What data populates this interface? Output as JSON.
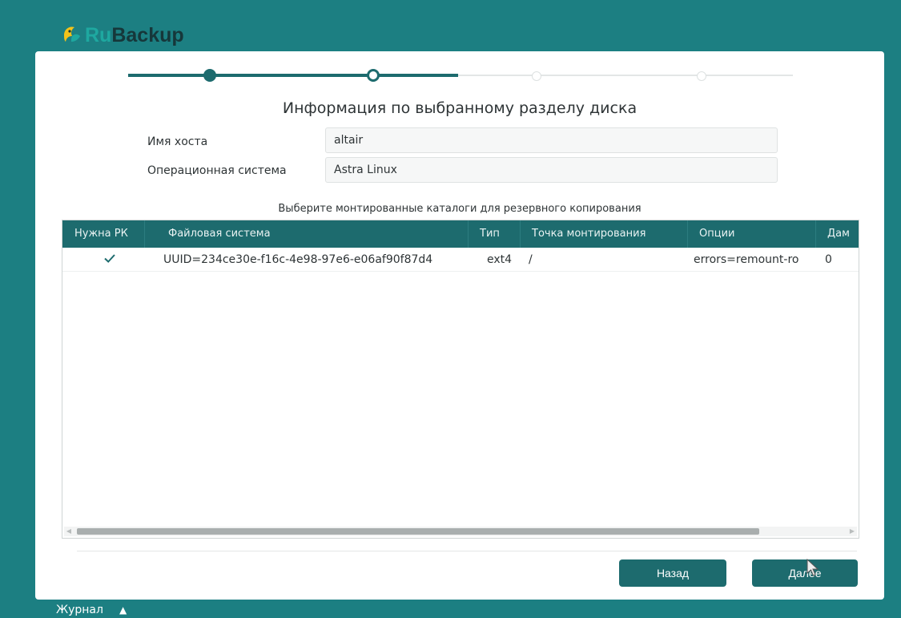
{
  "app": {
    "logo_prefix": "Ru",
    "logo_suffix": "Backup"
  },
  "wizard": {
    "title": "Информация по выбранному разделу диска",
    "steps_total": 4,
    "current_step": 2
  },
  "host": {
    "label": "Имя хоста",
    "value": "altair"
  },
  "os": {
    "label": "Операционная система",
    "value": "Astra Linux"
  },
  "table": {
    "caption": "Выберите монтированные каталоги для резервного копирования",
    "columns": [
      "Нужна РК",
      "Файловая система",
      "Тип",
      "Точка монтирования",
      "Опции",
      "Дам"
    ],
    "rows": [
      {
        "checked": true,
        "filesystem": "UUID=234ce30e-f16c-4e98-97e6-e06af90f87d4",
        "type": "ext4",
        "mountpoint": "/",
        "options": "errors=remount-ro",
        "dump": "0"
      }
    ]
  },
  "buttons": {
    "back": "Назад",
    "next": "Далее"
  },
  "footer": {
    "log_label": "Журнал",
    "toggle_icon": "chevron-up-icon"
  },
  "colors": {
    "background": "#1c7f82",
    "accent": "#1d6b6e",
    "panel": "#ffffff"
  }
}
